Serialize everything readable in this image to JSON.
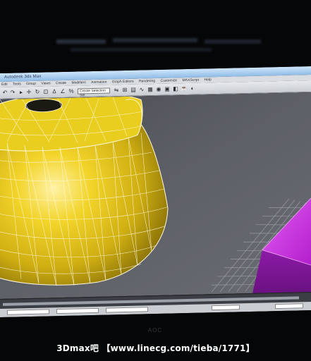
{
  "watermark": {
    "text": "3Dmax吧  【www.linecg.com/tieba/1771】"
  },
  "monitor": {
    "brand": "AOC"
  },
  "app": {
    "title": "Autodesk 3ds Max",
    "menu": [
      "Edit",
      "Tools",
      "Group",
      "Views",
      "Create",
      "Modifiers",
      "Animation",
      "Graph Editors",
      "Rendering",
      "Customize",
      "MAXScript",
      "Help"
    ],
    "selection_dropdown": "Create Selection Set"
  },
  "colors": {
    "teapot": "#e6c81a",
    "box": "#c22bd8",
    "viewport_bg": "#5c5e65",
    "wire": "#ffffff"
  }
}
